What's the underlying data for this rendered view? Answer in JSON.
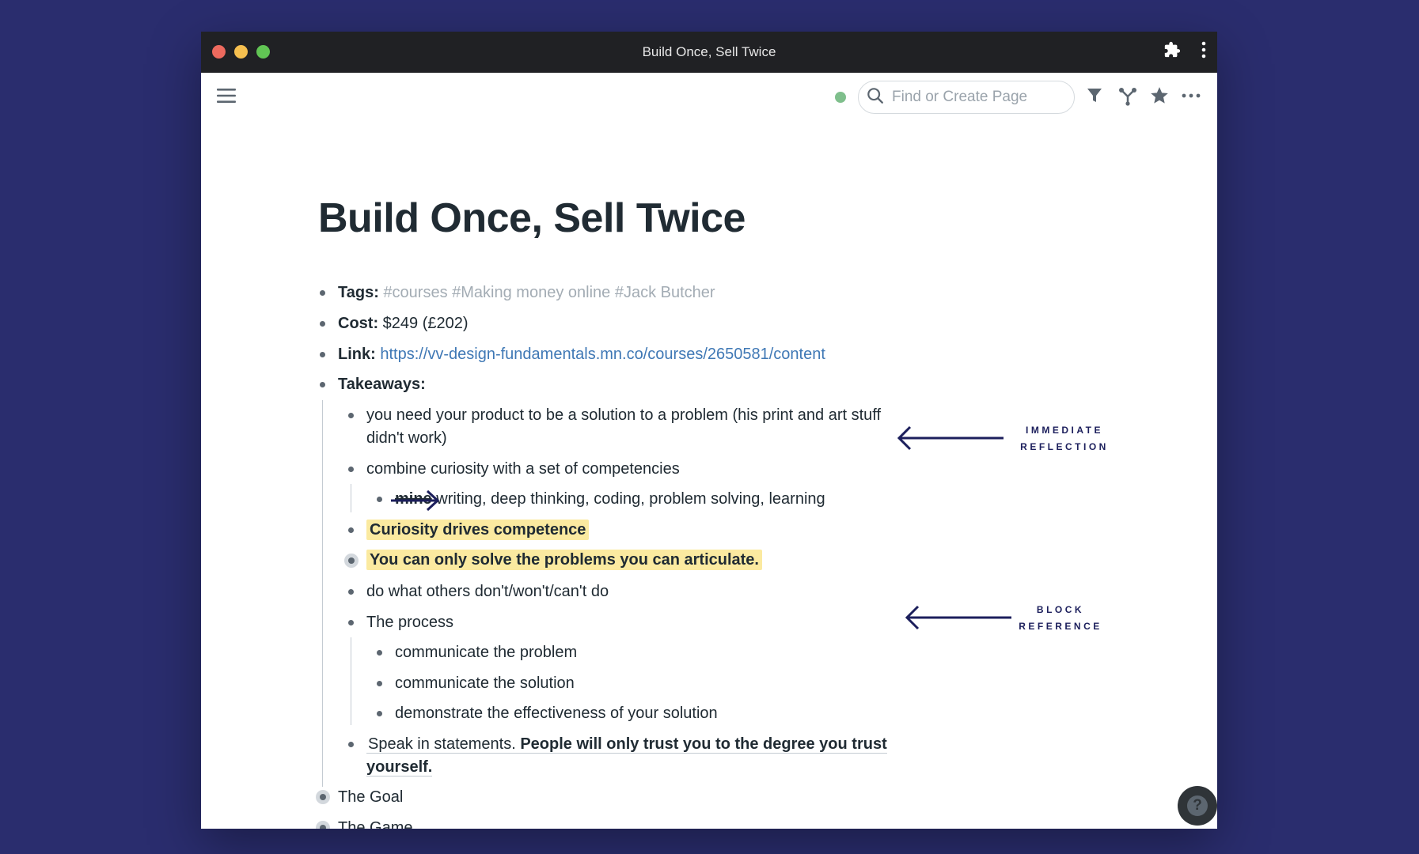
{
  "window": {
    "title": "Build Once, Sell Twice"
  },
  "toolbar": {
    "search_placeholder": "Find or Create Page"
  },
  "page": {
    "title": "Build Once, Sell Twice",
    "tags_label": "Tags:",
    "tags": [
      "#courses",
      "#Making money online",
      "#Jack Butcher"
    ],
    "cost_label": "Cost:",
    "cost_value": "$249 (£202)",
    "link_label": "Link:",
    "link_url": "https://vv-design-fundamentals.mn.co/courses/2650581/content",
    "takeaways_label": "Takeaways:",
    "takeaways": {
      "item1_line1": "you need your product to be a solution to a problem (his print and art stuff",
      "item1_line2": "didn't work)",
      "item2": "combine curiosity with a set of competencies",
      "item2_child_strike": "mine",
      "item2_child_rest": "writing, deep thinking, coding, problem solving, learning",
      "item3": "Curiosity drives competence",
      "item4": "You can only solve the problems you can articulate.",
      "item5": "do what others don't/won't/can't do",
      "item6": "The process",
      "process_steps": [
        "communicate the problem",
        "communicate the solution",
        "demonstrate the effectiveness of your solution"
      ],
      "item7_plain": "Speak in statements.",
      "item7_bold_line1": "People will only trust you to the degree you trust",
      "item7_bold_line2": "yourself."
    },
    "goal": "The Goal",
    "game": "The Game"
  },
  "annotations": {
    "immediate_line1": "IMMEDIATE",
    "immediate_line2": "REFLECTION",
    "block_line1": "BLOCK",
    "block_line2": "REFERENCE"
  },
  "help": {
    "label": "?"
  },
  "colors": {
    "background": "#2a2d6e",
    "titlebar": "#202124",
    "highlight": "#fbeaa0",
    "link": "#3f78b5",
    "tag": "#a3acb4",
    "annotation": "#1c1f5c",
    "sync": "#7fbf8c"
  }
}
